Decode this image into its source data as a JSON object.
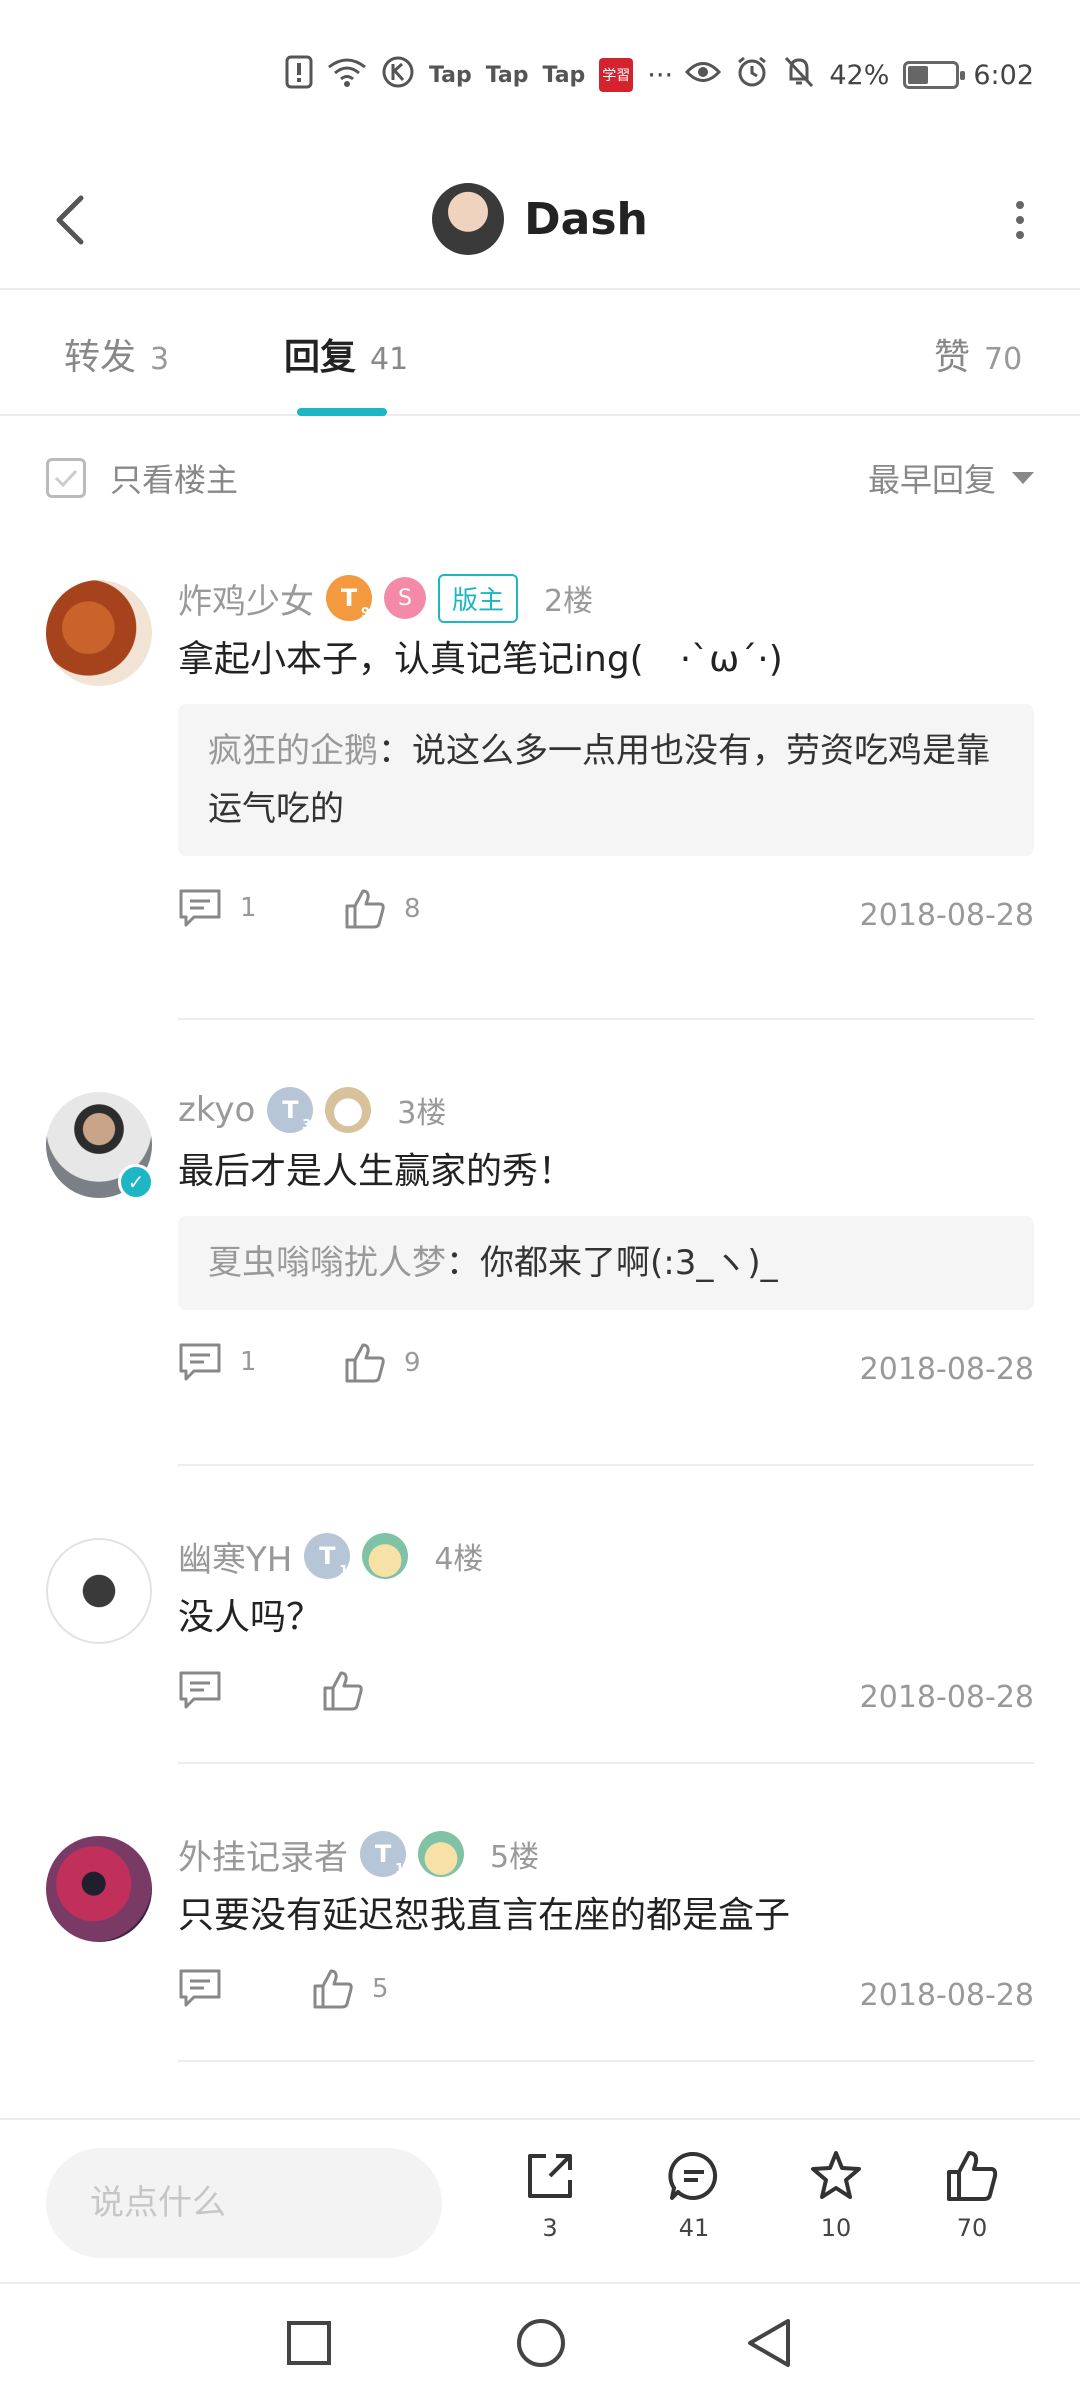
{
  "status_bar": {
    "tap_labels": [
      "Tap",
      "Tap",
      "Tap"
    ],
    "red_app_label": "学習",
    "more": "···",
    "battery_level": 0.42,
    "battery_text": "42%",
    "time": "6:02"
  },
  "header": {
    "title": "Dash"
  },
  "tabs": [
    {
      "label": "转发",
      "count": "3"
    },
    {
      "label": "回复",
      "count": "41",
      "active": true
    },
    {
      "label": "赞",
      "count": "70"
    }
  ],
  "filter": {
    "only_op_label": "只看楼主",
    "sort_label": "最早回复"
  },
  "comments": [
    {
      "username": "炸鸡少女",
      "level": "T",
      "level_sub": "9",
      "extra_badge": "S",
      "role": "版主",
      "floor": "2楼",
      "content": "拿起小本子，认真记笔记ing(　·`ω´·)",
      "quote": {
        "user": "疯狂的企鹅",
        "text": "：说这么多一点用也没有，劳资吃鸡是靠运气吃的"
      },
      "reply_count": "1",
      "like_count": "8",
      "date": "2018-08-28"
    },
    {
      "username": "zkyo",
      "level": "T",
      "level_sub": "3",
      "floor": "3楼",
      "content": "最后才是人生赢家的秀！",
      "quote": {
        "user": "夏虫嗡嗡扰人梦",
        "text": "：你都来了啊(:3_ヽ)_"
      },
      "reply_count": "1",
      "like_count": "9",
      "date": "2018-08-28"
    },
    {
      "username": "幽寒YH",
      "level": "T",
      "level_sub": "1",
      "floor": "4楼",
      "content": "没人吗？",
      "reply_count": "",
      "like_count": "",
      "date": "2018-08-28"
    },
    {
      "username": "外挂记录者",
      "level": "T",
      "level_sub": "1",
      "floor": "5楼",
      "content": "只要没有延迟恕我直言在座的都是盒子",
      "reply_count": "",
      "like_count": "5",
      "date": "2018-08-28"
    }
  ],
  "bottom_bar": {
    "input_placeholder": "说点什么",
    "share_count": "3",
    "comment_count": "41",
    "favorite_count": "10",
    "like_count": "70"
  },
  "colors": {
    "accent": "#1db6c4",
    "badge_orange": "#f39a3f",
    "badge_silver": "#b7c6d6"
  }
}
